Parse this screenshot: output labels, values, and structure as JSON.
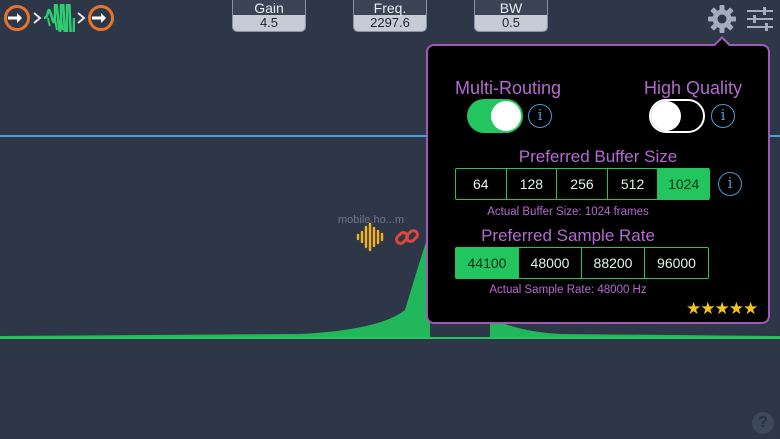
{
  "routing": {
    "input_icon": "arrow-in-circle-icon",
    "effect_icon": "waveform-icon",
    "output_icon": "arrow-out-circle-icon"
  },
  "params": {
    "gain": {
      "label": "Gain",
      "value": "4.5"
    },
    "freq": {
      "label": "Freq.",
      "value": "2297.6"
    },
    "bw": {
      "label": "BW",
      "value": "0.5"
    }
  },
  "toolbar": {
    "settings_icon": "gear-icon",
    "mixer_icon": "sliders-icon"
  },
  "graph": {
    "watermark": "mobile.ho...m",
    "help_label": "?"
  },
  "settings": {
    "multi_routing": {
      "label": "Multi-Routing",
      "on": true
    },
    "high_quality": {
      "label": "High Quality",
      "on": false
    },
    "info_label": "i",
    "buffer": {
      "title": "Preferred Buffer Size",
      "options": [
        "64",
        "128",
        "256",
        "512",
        "1024"
      ],
      "selected": "1024",
      "actual": "Actual Buffer Size: 1024 frames"
    },
    "sample_rate": {
      "title": "Preferred Sample Rate",
      "options": [
        "44100",
        "48000",
        "88200",
        "96000"
      ],
      "selected": "44100",
      "actual": "Actual Sample Rate: 48000 Hz"
    },
    "rating": "★★★★★"
  },
  "colors": {
    "background": "#2d3748",
    "accent_green": "#22c55e",
    "accent_purple": "#b46ad0",
    "accent_blue": "#4a9ad6",
    "routing_orange": "#e8742c"
  }
}
